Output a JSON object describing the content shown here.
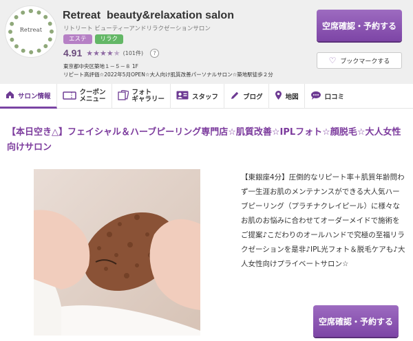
{
  "header": {
    "logo_text": "Retreat",
    "salon_name": "Retreat  beauty&relaxation salon",
    "salon_kana": "リトリート ビューティーアンドリラクゼーションサロン",
    "tags": [
      "エステ",
      "リラク"
    ],
    "rating": "4.91",
    "rating_value": 4.91,
    "review_count": "(101件)",
    "help_icon_text": "?",
    "address": "東京都中央区築地１－５－８ 1F",
    "catchcopy": "リピート高評価☆2022年5月OPEN☆大人向け肌質改善パーソナルサロン☆築地駅徒歩２分",
    "reserve_label": "空席確認・予約する",
    "bookmark_label": "ブックマークする"
  },
  "nav": {
    "items": [
      {
        "label": "サロン情報",
        "icon": "home-icon"
      },
      {
        "label": "クーポン",
        "label2": "メニュー",
        "icon": "ticket-icon"
      },
      {
        "label": "フォト",
        "label2": "ギャラリー",
        "icon": "photo-icon"
      },
      {
        "label": "スタッフ",
        "icon": "staff-card-icon"
      },
      {
        "label": "ブログ",
        "icon": "pencil-icon"
      },
      {
        "label": "地図",
        "icon": "map-pin-icon"
      },
      {
        "label": "口コミ",
        "icon": "speech-bubble-icon"
      }
    ]
  },
  "content": {
    "headline": "【本日空き△】フェイシャル＆ハーブピーリング専門店☆肌質改善☆IPLフォト☆顔脱毛☆大人女性向けサロン",
    "description": "【東銀座4分】圧倒的なリピート率＋肌質年齢問わず一生涯お肌のメンテナンスができる大人気ハーブピーリング（プラチナクレイピール）に様々なお肌のお悩みに合わせてオーダーメイドで施術をご提案♪こだわりのオールハンドで究極の至福リラクゼーションを是非♪IPL光フォト＆脱毛ケアも♪大人女性向けプライベートサロン☆",
    "reserve_label": "空席確認・予約する"
  },
  "colors": {
    "accent": "#7c3b9d",
    "esthe_tag": "#b680c5",
    "relax_tag": "#63b766",
    "header_bg": "#efefef"
  }
}
